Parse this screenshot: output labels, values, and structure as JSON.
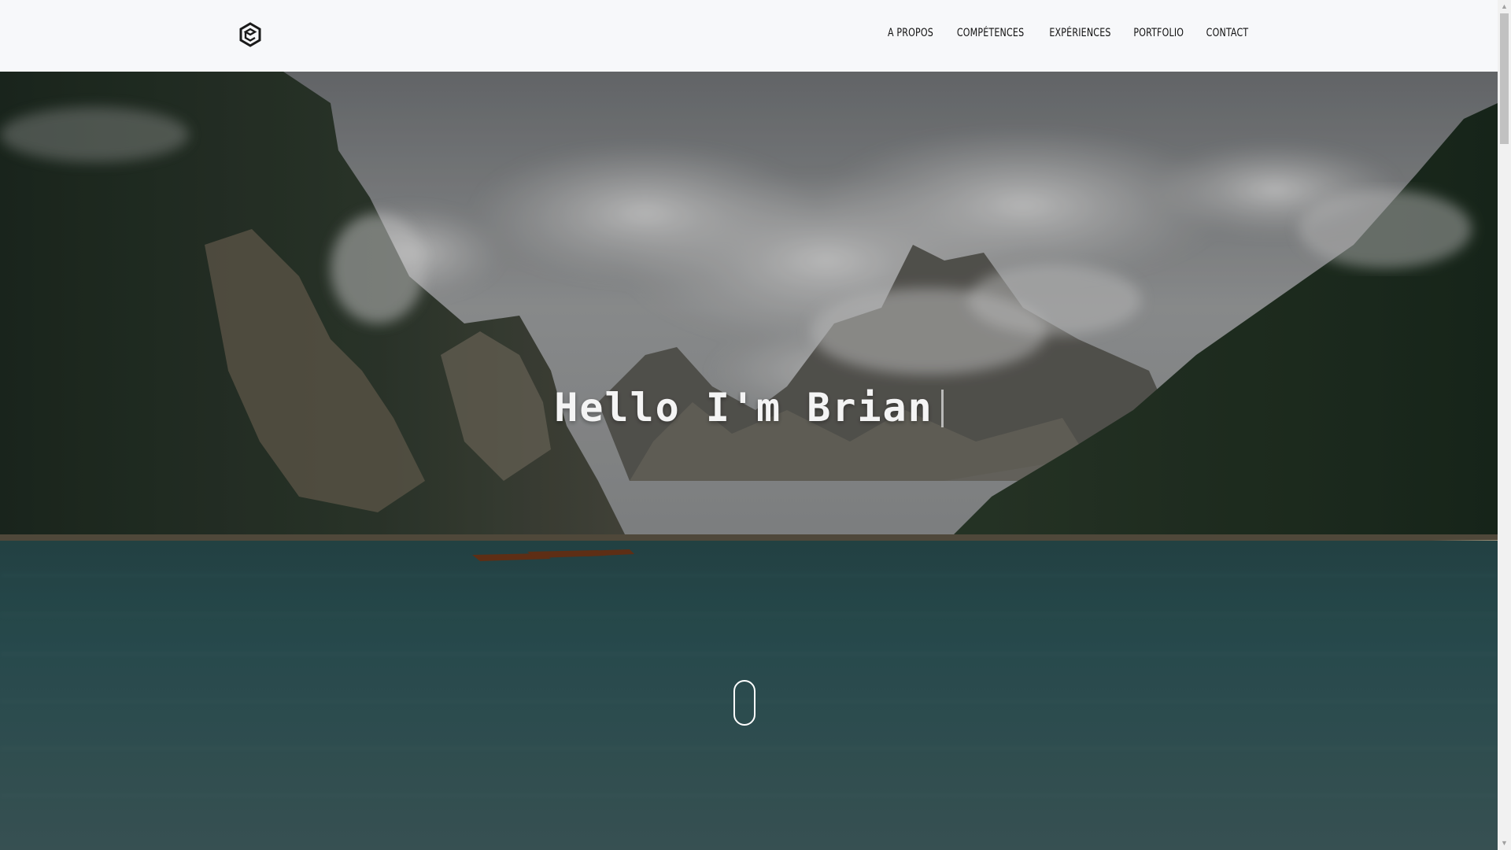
{
  "header": {
    "logo_icon": "hexagon-logo-icon",
    "nav": [
      {
        "label": "A PROPOS"
      },
      {
        "label": "COMPÉTENCES"
      },
      {
        "label": "EXPÉRIENCES"
      },
      {
        "label": "PORTFOLIO"
      },
      {
        "label": "CONTACT"
      }
    ]
  },
  "hero": {
    "title": "Hello I'm Brian",
    "scroll_icon": "mouse-scroll-icon"
  },
  "scrollbar": {
    "up_icon": "scroll-up-icon",
    "down_icon": "scroll-down-icon",
    "up_glyph": "▲",
    "down_glyph": "▼"
  }
}
